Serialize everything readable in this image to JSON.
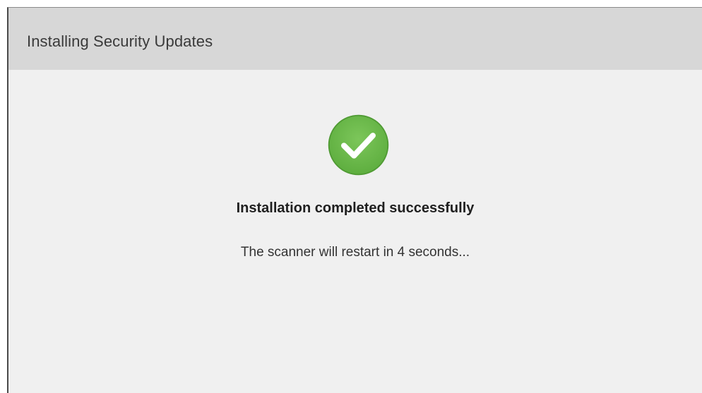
{
  "window": {
    "title": "Installing Security Updates"
  },
  "status": {
    "icon": "success-check-icon",
    "headline": "Installation completed successfully",
    "message": "The scanner will restart in 4 seconds..."
  },
  "colors": {
    "title_bar": "#d7d7d7",
    "body_bg": "#f0f0f0",
    "success_green": "#6db84a",
    "success_green_dark": "#4f9a33"
  }
}
